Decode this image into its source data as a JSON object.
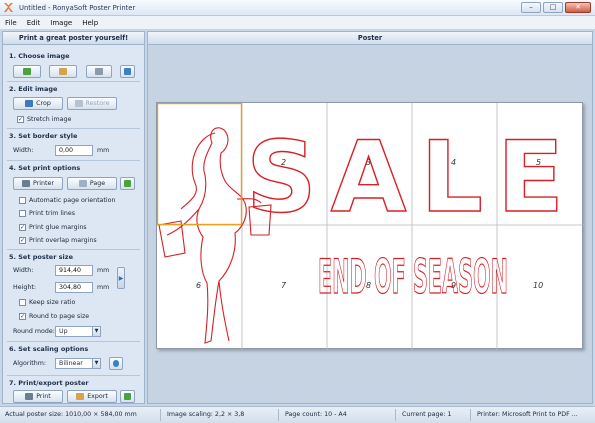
{
  "window": {
    "title": "Untitled - RonyaSoft Poster Printer"
  },
  "menu": [
    "File",
    "Edit",
    "Image",
    "Help"
  ],
  "left_panel": {
    "header": "Print a great poster yourself!",
    "s1": {
      "title": "1. Choose image"
    },
    "s2": {
      "title": "2. Edit image",
      "crop": "Crop",
      "restore": "Restore",
      "stretch": "Stretch image"
    },
    "s3": {
      "title": "3. Set border style",
      "width_label": "Width:",
      "width_value": "0,00",
      "unit": "mm"
    },
    "s4": {
      "title": "4. Set print options",
      "printer": "Printer",
      "page": "Page",
      "auto_orient": "Automatic page orientation",
      "trim": "Print trim lines",
      "glue": "Print glue margins",
      "overlap": "Print overlap margins"
    },
    "s5": {
      "title": "5. Set poster size",
      "width_label": "Width:",
      "width_value": "914,40",
      "height_label": "Height:",
      "height_value": "304,80",
      "unit": "mm",
      "keep_ratio": "Keep size ratio",
      "round_page": "Round to page size",
      "round_mode_label": "Round mode:",
      "round_mode_value": "Up"
    },
    "s6": {
      "title": "6. Set scaling options",
      "algorithm_label": "Algorithm:",
      "algorithm_value": "Bilinear"
    },
    "s7": {
      "title": "7. Print/export poster",
      "print": "Print",
      "export": "Export"
    }
  },
  "right_panel": {
    "header": "Poster",
    "pages": [
      "2",
      "3",
      "4",
      "5",
      "6",
      "7",
      "8",
      "9",
      "10"
    ],
    "poster_text": {
      "line1": "SALE",
      "line2": "END OF SEASON"
    }
  },
  "status": {
    "actual_size": "Actual poster size: 1010,00 × 584,00 mm",
    "scaling": "Image scaling: 2,2 × 3,8",
    "page_count": "Page count: 10 - A4",
    "current_page": "Current page: 1",
    "printer": "Printer: Microsoft Print to PDF ..."
  },
  "colors": {
    "accent": "#e8a020",
    "poster_red": "#d81f26"
  }
}
